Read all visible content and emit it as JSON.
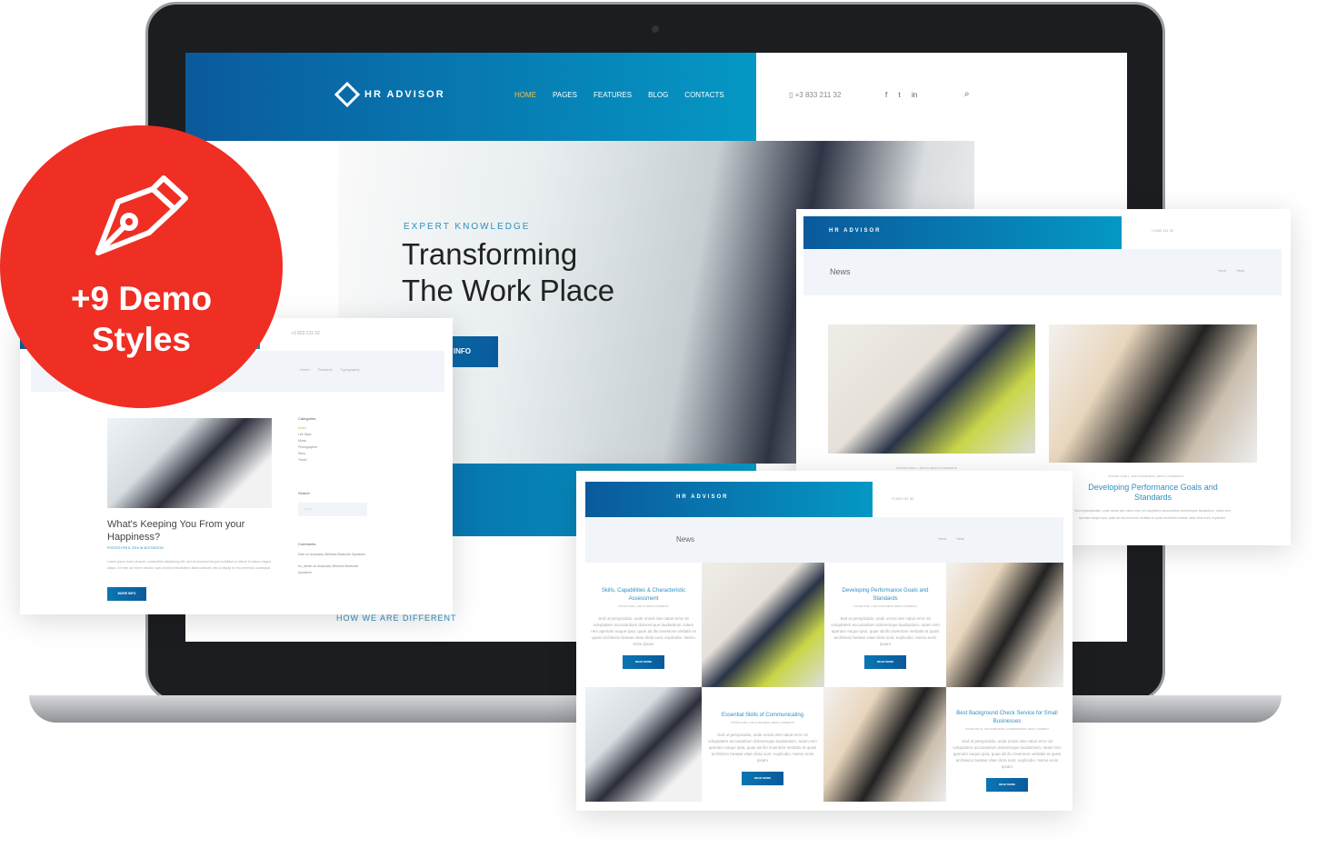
{
  "brand": "HR ADVISOR",
  "nav": [
    "HOME",
    "PAGES",
    "FEATURES",
    "BLOG",
    "CONTACTS"
  ],
  "phone": "+3 833 211 32",
  "social": [
    "f",
    "t",
    "in"
  ],
  "hero": {
    "eyebrow": "EXPERT KNOWLEDGE",
    "title1": "Transforming",
    "title2": "The Work Place",
    "button": "INFO",
    "section": "HOW WE ARE DIFFERENT"
  },
  "badge": {
    "line1": "+9 Demo",
    "line2": "Styles",
    "color": "#ef2e24",
    "icon": "pen-nib-icon"
  },
  "left_card": {
    "breadcrumb": [
      "Home",
      "Features",
      "Typography"
    ],
    "post_title": "What's Keeping You From your Happiness?",
    "post_meta": "POSTED FEB 8, 2016 IN MOTIVATION",
    "post_text": "Lorem ipsum dolor sit amet, consectetur adipisicing elit, sed do eiusmod tempor incididunt ut labore et dolore magna aliqua. Ut enim ad minim veniam, quis nostrud exercitation ullamco laboris nisi ut aliquip ex ea commodo consequat.",
    "button": "MORE INFO",
    "categories_title": "Categories",
    "categories": [
      "Audio",
      "Life Style",
      "Music",
      "Photographer",
      "Story",
      "Travel"
    ],
    "search_title": "Search",
    "search_placeholder": "Search",
    "comments_title": "Comments",
    "comments": [
      "Kate on Audyssey Wireless Bluetooth Speakers",
      "trx_admin on Audyssey Wireless Bluetooth Speakers"
    ]
  },
  "right_card": {
    "page_title": "News",
    "breadcrumb": [
      "Home",
      "News"
    ],
    "meta1": "POSTED APRIL 1, 2016 IN NEWS 0 COMMENTS",
    "meta2": "POSTED JUNE 1, 2016 IN BUSINESS, NEWS 0 COMMENTS",
    "post_title": "Developing Performance Goals and Standards",
    "post_text": "Sed ut perspiciatis, unde omnis iste natus error sit voluptatem accusantium doloremque laudantium, totam rem aperiam eaque ipsa, quae ab illo inventore veritatis et quasi architecto beatae vitae dicta sunt, explicabo."
  },
  "bottom_card": {
    "page_title": "News",
    "breadcrumb": [
      "Home",
      "News"
    ],
    "posts": [
      {
        "title": "Skills, Capabilities & Characteristic Assessment",
        "meta": "POSTED JUNE 1, 2016 IN NEWS 0 COMMENTS"
      },
      {
        "title": "Developing Performance Goals and Standards",
        "meta": "POSTED JUNE 1, 2016 IN BUSINESS, NEWS 0 COMMENTS"
      },
      {
        "title": "Essential Skills of Communicating",
        "meta": "POSTED JUNE 1, 2016 IN BUSINESS, NEWS 0 COMMENTS"
      },
      {
        "title": "Best Background Check Service for Small Businesses",
        "meta": "POSTED MAY 31, 2016 IN BRANDING, ENTREPRENEURS, NEWS 1 COMMENT"
      }
    ],
    "post_text": "Sed ut perspiciatis, unde omnis iste natus error sit voluptatem accusantium doloremque laudantium, totam rem aperiam eaque ipsa, quae ab illo inventore veritatis et quasi architecto beatae vitae dicta sunt, explicabo. Nemo enim ipsam",
    "button": "READ MORE"
  }
}
